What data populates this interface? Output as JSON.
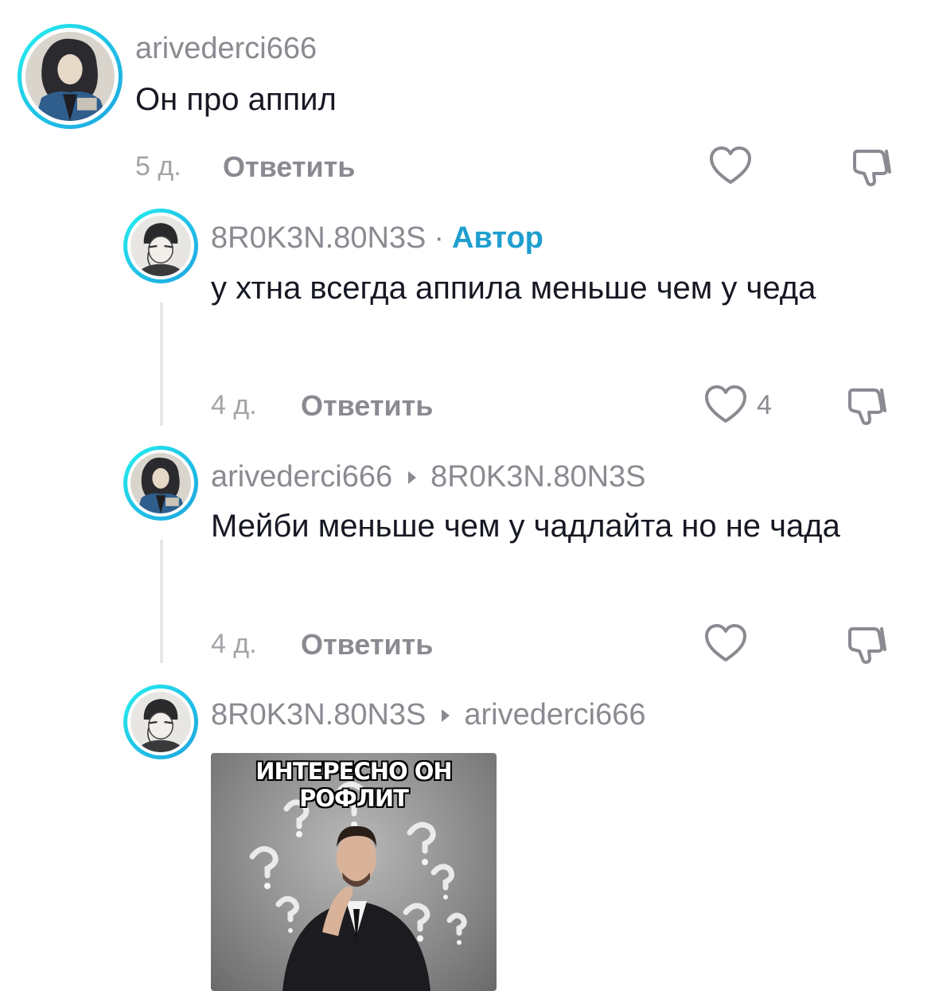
{
  "comments": [
    {
      "username": "arivederci666",
      "text": "Он про аппил",
      "time": "5 д.",
      "reply_label": "Ответить"
    },
    {
      "username": "8R0K3N.80N3S",
      "separator": "·",
      "badge": "Автор",
      "text": "у хтна всегда аппила меньше чем у чеда",
      "time": "4 д.",
      "reply_label": "Ответить",
      "like_count": "4"
    },
    {
      "username": "arivederci666",
      "reply_to": "8R0K3N.80N3S",
      "text": "Мейби меньше чем у чадлайта но не чада",
      "time": "4 д.",
      "reply_label": "Ответить"
    },
    {
      "username": "8R0K3N.80N3S",
      "reply_to": "arivederci666",
      "meme_caption": "ИНТЕРЕСНО ОН РОФЛИТ"
    }
  ],
  "colors": {
    "accent_author": "#1e9ecf",
    "avatar_ring": "#25f4ee",
    "muted_text": "#8a8b91"
  },
  "icons": {
    "like": "heart-outline-icon",
    "dislike": "thumbs-down-icon",
    "reply_to": "triangle-right-icon"
  }
}
